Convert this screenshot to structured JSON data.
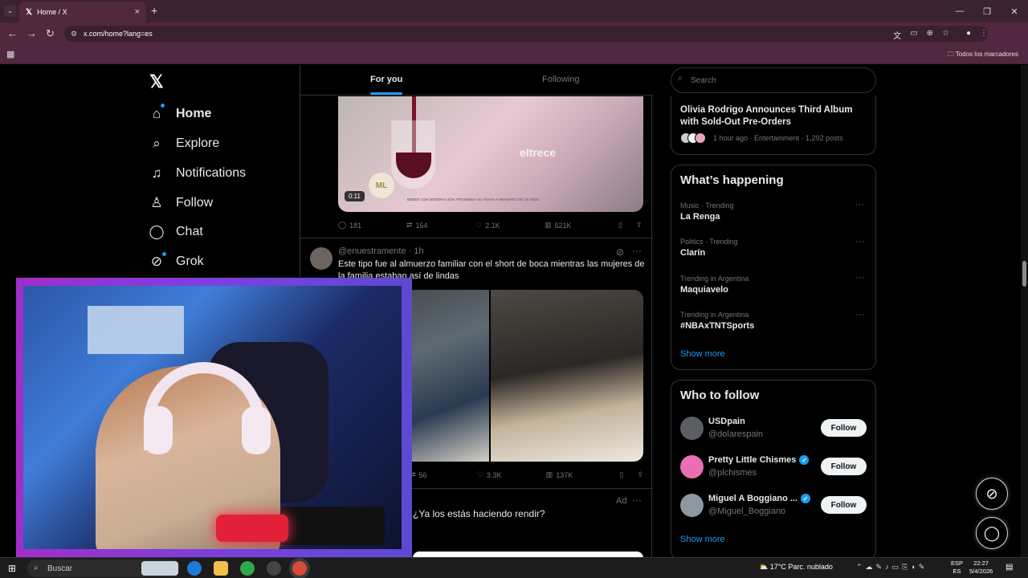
{
  "browser": {
    "tab_title": "Home / X",
    "url": "x.com/home?lang=es",
    "bookmarks_all": "Todos los marcadores"
  },
  "nav": {
    "items": [
      {
        "label": "Home",
        "icon": "home-icon"
      },
      {
        "label": "Explore",
        "icon": "search-icon"
      },
      {
        "label": "Notifications",
        "icon": "bell-icon"
      },
      {
        "label": "Follow",
        "icon": "person-plus-icon"
      },
      {
        "label": "Chat",
        "icon": "chat-icon"
      },
      {
        "label": "Grok",
        "icon": "grok-icon"
      }
    ]
  },
  "timeline": {
    "tabs": [
      "For you",
      "Following"
    ],
    "post1": {
      "duration": "0:11",
      "watermark": "eltrece",
      "logo": "ML",
      "legal": "BEBER CON MODERACIÓN. PROHIBIDA SU VENTA A MENORES DE 18 AÑOS.",
      "replies": "181",
      "reposts": "154",
      "likes": "2.1K",
      "views": "521K"
    },
    "post2": {
      "handle": "@enuestramente · 1h",
      "text": "Este tipo fue al almuerzo familiar con el short de boca mientras las mujeres de la familia estaban así de lindas",
      "reposts": "56",
      "likes": "3.3K",
      "views": "137K"
    },
    "ad": {
      "label": "Ad",
      "text": "¿Ya los estás haciendo rendir?"
    }
  },
  "sidebar": {
    "search_placeholder": "Search",
    "news": {
      "title": "Olivia Rodrigo Announces Third Album with Sold-Out Pre-Orders",
      "meta": "1 hour ago · Entertainment · 1,292 posts"
    },
    "whats_happening": {
      "heading": "What’s happening",
      "trends": [
        {
          "meta": "Music · Trending",
          "name": "La Renga"
        },
        {
          "meta": "Politics · Trending",
          "name": "Clarín"
        },
        {
          "meta": "Trending in Argentina",
          "name": "Maquiavelo"
        },
        {
          "meta": "Trending in Argentina",
          "name": "#NBAxTNTSports"
        }
      ],
      "show_more": "Show more"
    },
    "who_to_follow": {
      "heading": "Who to follow",
      "accounts": [
        {
          "name": "USDpain",
          "handle": "@dolarespain",
          "verified": false,
          "avatar_color": "#5b5f63"
        },
        {
          "name": "Pretty Little Chismes",
          "handle": "@plchismes",
          "verified": true,
          "avatar_color": "#e86fb3"
        },
        {
          "name": "Miguel A Boggiano ...",
          "handle": "@Miguel_Boggiano",
          "verified": true,
          "avatar_color": "#8d98a3"
        }
      ],
      "follow_label": "Follow",
      "show_more": "Show more"
    }
  },
  "taskbar": {
    "search": "Buscar",
    "weather": "17°C  Parc. nublado",
    "lang_top": "ESP",
    "lang_bottom": "ES",
    "time": "22:27",
    "date": "5/4/2026"
  },
  "colors": {
    "accent": "#1d9bf0",
    "browser_frame": "#51283f",
    "cam_border": "#a22ec9"
  }
}
